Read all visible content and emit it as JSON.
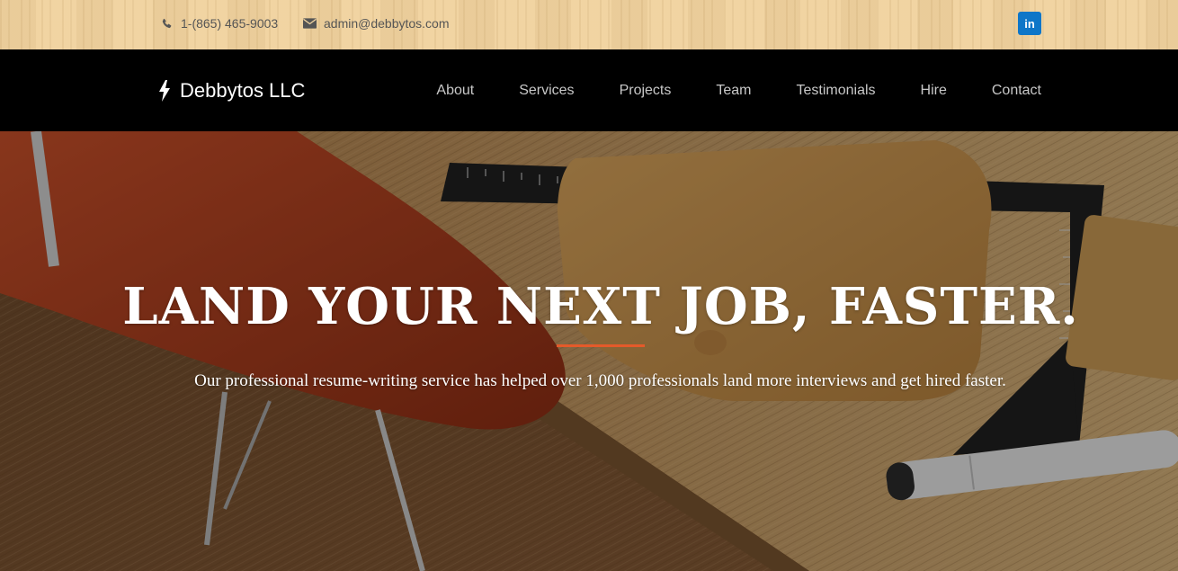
{
  "topbar": {
    "phone": "1-(865) 465-9003",
    "email": "admin@debbytos.com",
    "icons": {
      "phone": "phone-icon",
      "email": "envelope-icon",
      "social": "linkedin-icon"
    },
    "social_label": "in"
  },
  "navbar": {
    "brand": "Debbytos LLC",
    "brand_icon": "lightning-bolt-icon",
    "items": [
      {
        "label": "About"
      },
      {
        "label": "Services"
      },
      {
        "label": "Projects"
      },
      {
        "label": "Team"
      },
      {
        "label": "Testimonials"
      },
      {
        "label": "Hire"
      },
      {
        "label": "Contact"
      }
    ]
  },
  "hero": {
    "headline": "LAND YOUR NEXT JOB, FASTER.",
    "subtitle": "Our professional resume-writing service has helped over 1,000 professionals land more interviews and get hired faster.",
    "accent_color": "#e45a2a"
  },
  "colors": {
    "topbar_bg": "#f0d3a0",
    "navbar_bg": "#000000",
    "linkedin": "#0e76c8",
    "accent": "#e45a2a"
  }
}
